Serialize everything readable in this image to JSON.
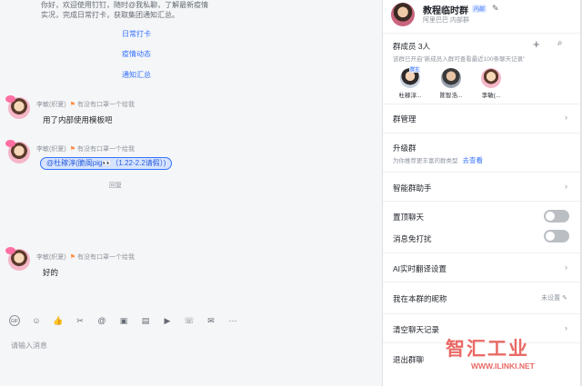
{
  "chat": {
    "bot_text_lines": [
      "你好，欢迎使用钉钉，随时@我私聊，了解最新疫情",
      "实况，完成日常打卡，获取集团通知汇总。"
    ],
    "bot_links": [
      "日常打卡",
      "疫情动态",
      "通知汇总"
    ],
    "messages": [
      {
        "sender": "李敏(织夏)",
        "status": "有没有口罩一个给我",
        "text": "用了内部使用模板吧"
      },
      {
        "sender": "李敏(织夏)",
        "status": "有没有口罩一个给我",
        "mention": "@杜稼淳(脆阁pig👀（1.22-2.2请假）)",
        "reply": "回复"
      },
      {
        "sender": "李敏(织夏)",
        "status": "有没有口罩一个给我",
        "text": "好的"
      }
    ],
    "toolbar_icons": [
      "gif-icon",
      "emoji-icon",
      "thumbs-up-icon",
      "scissors-icon",
      "at-icon",
      "image-icon",
      "folder-icon",
      "video-icon",
      "phone-icon",
      "mail-icon",
      "more-icon"
    ],
    "toolbar_glyphs": [
      "GIF",
      "☺",
      "👍",
      "✂",
      "@",
      "▣",
      "▤",
      "▶",
      "☏",
      "✉",
      "···"
    ],
    "input_placeholder": "请输入消息"
  },
  "panel": {
    "group_name": "教程临时群",
    "group_tag": "内部",
    "group_sub": "阿里巴巴  内部群",
    "members_label": "群成员 3人",
    "members_note": "该群已开启\"新成员入群可查看最近100条聊天记录\"",
    "members": [
      {
        "name": "杜稼淳...",
        "owner_tag": "群主"
      },
      {
        "name": "陈智浩..."
      },
      {
        "name": "李敏(..."
      }
    ],
    "group_manage": "群管理",
    "upgrade_label": "升级群",
    "upgrade_note": "为你推荐更丰富的群类型",
    "upgrade_link": "去查看",
    "assistant": "智能群助手",
    "pin_chat": "置顶聊天",
    "mute": "消息免打扰",
    "ai_translate": "AI实时翻译设置",
    "nickname_label": "我在本群的昵称",
    "nickname_value": "未设置",
    "clear_history": "清空聊天记录",
    "leave_group": "退出群聊"
  },
  "watermark": {
    "title": "智汇工业",
    "url": "WWW.ILINKI.NET"
  }
}
